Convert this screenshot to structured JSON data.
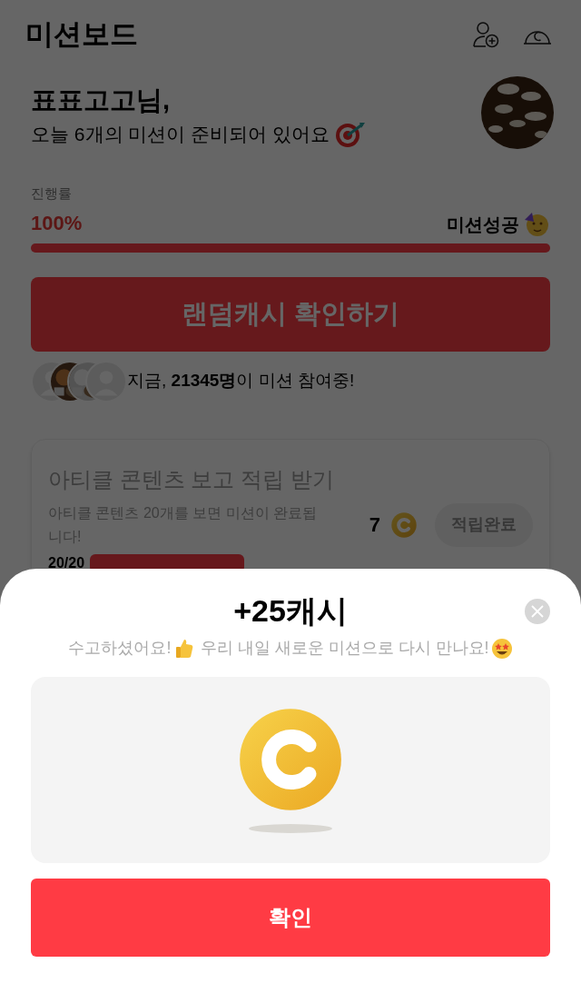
{
  "header": {
    "title": "미션보드"
  },
  "greeting": {
    "name": "표표고고님,",
    "message": "오늘 6개의 미션이 준비되어 있어요"
  },
  "progress": {
    "label": "진행률",
    "percent": "100%",
    "level": 1,
    "status": "미션성공"
  },
  "random_cash_button": "랜덤캐시 확인하기",
  "participants": {
    "text": "지금, **21345명**이 미션 참여중!",
    "avatars": [
      {
        "kind": "silhouette"
      },
      {
        "kind": "picture"
      },
      {
        "kind": "picture"
      },
      {
        "kind": "silhouette"
      }
    ]
  },
  "mission_card": {
    "title": "아티클 콘텐츠 보고 적립 받기",
    "description": "아티클 콘텐츠 20개를 보면 미션이 완료됩니다!",
    "reward": "7",
    "button": "적립완료",
    "count": "20/20",
    "level": 1
  },
  "sheet": {
    "title": "+25캐시",
    "message": "수고하셨어요!",
    "message_2": "우리 내일 새로운 미션으로 다시 만나요!",
    "confirm": "확인"
  }
}
